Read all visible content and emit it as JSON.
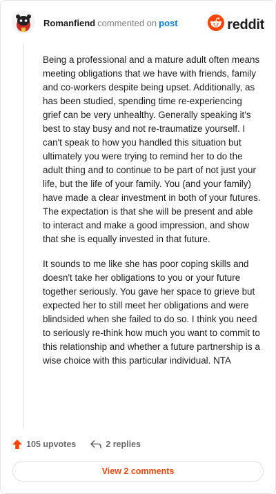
{
  "header": {
    "author": "Romanfiend",
    "action_text": "commented on",
    "post_link": "post",
    "brand": "reddit",
    "avatar_icon": "snoo-avatar-icon",
    "brand_icon": "reddit-logo-icon"
  },
  "comment": {
    "paragraphs": [
      "Being a professional and a mature adult often means meeting obligations that we have with friends, family and co-workers despite being upset. Additionally, as has been studied, spending time re-experiencing grief can be very unhealthy. Generally speaking it's best to stay busy and not re-traumatize yourself. I can't speak to how you handled this situation but ultimately you were trying to remind her to do the adult thing and to continue to be part of not just your life, but the life of your family. You (and your family) have made a clear investment in both of your futures. The expectation is that she will be present and able to interact and make a good impression, and show that she is equally invested in that future.",
      "It sounds to me like she has poor coping skills and doesn't take her obligations to you or your future together seriously. You gave her space to grieve but expected her to still meet her obligations and were blindsided when she failed to do so. I think you need to seriously re-think how much you want to commit to this relationship and whether a future partnership is a wise choice with this particular individual. NTA"
    ]
  },
  "actions": {
    "upvotes_label": "105 upvotes",
    "replies_label": "2 replies",
    "upvote_icon": "upvote-arrow-icon",
    "reply_icon": "reply-arrow-icon"
  },
  "footer": {
    "view_comments_label": "View 2 comments"
  },
  "colors": {
    "reddit_orange": "#ff4500",
    "link_blue": "#0079d3",
    "button_text": "#e8490d"
  }
}
